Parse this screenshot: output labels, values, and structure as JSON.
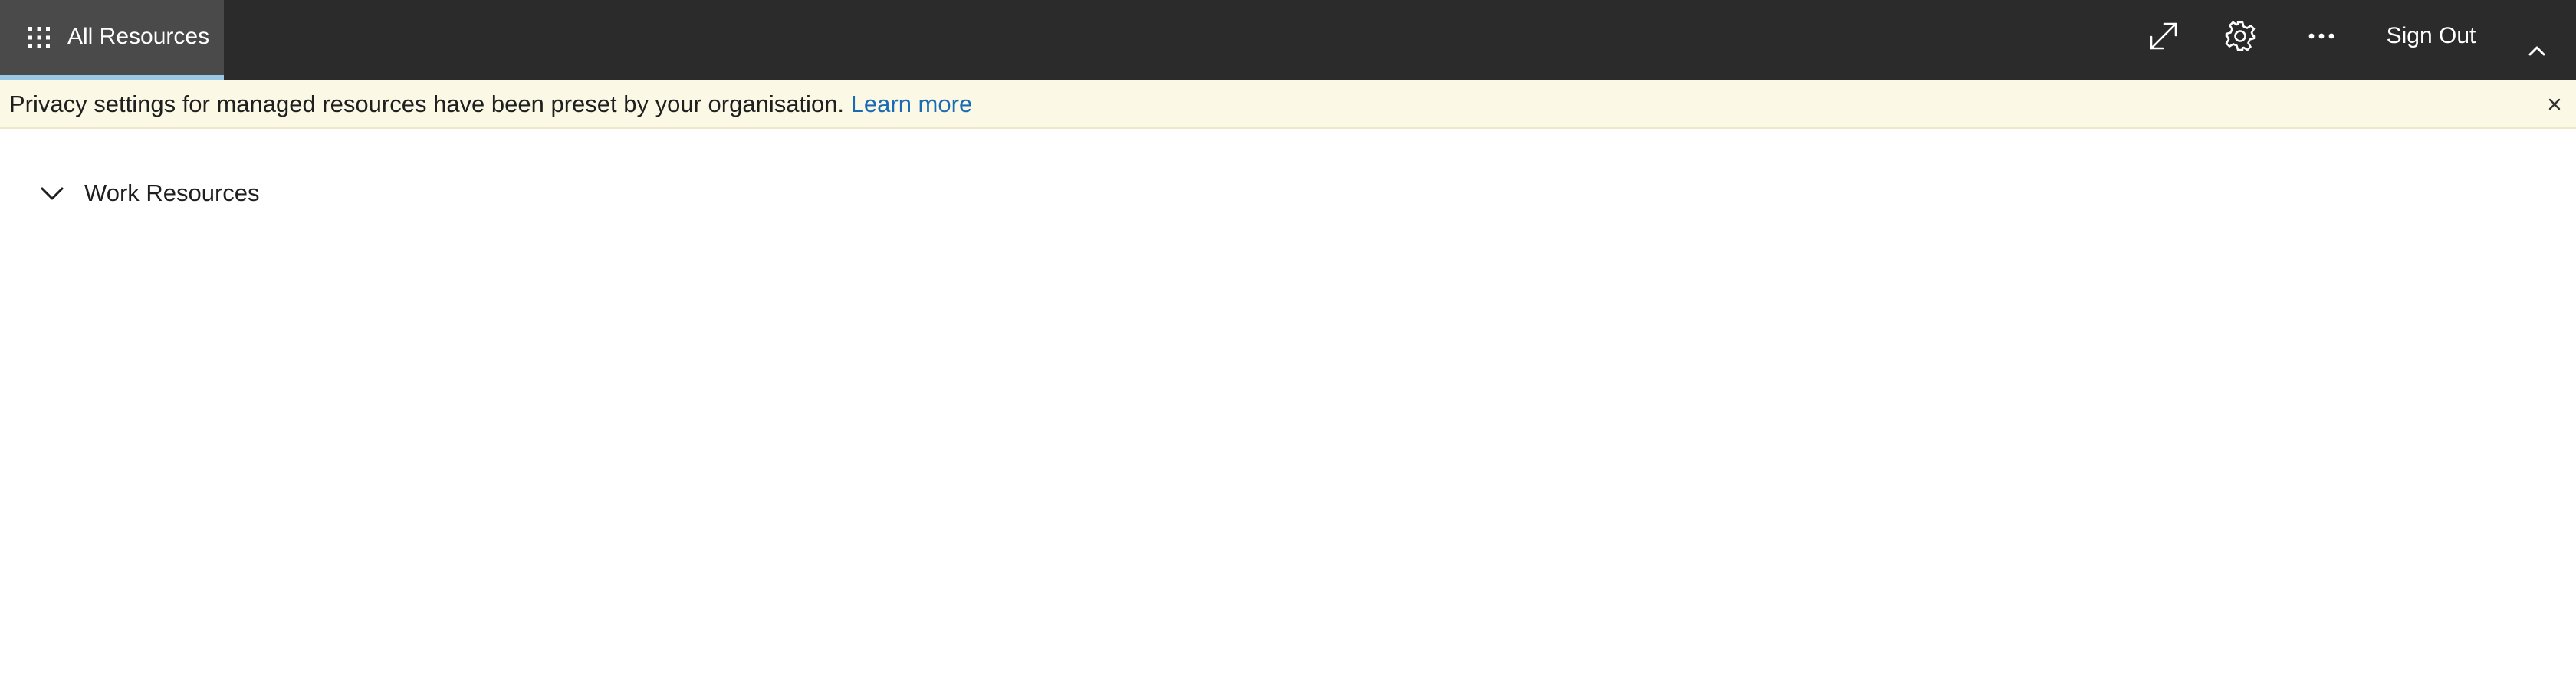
{
  "header": {
    "app_tab_label": "All Resources",
    "app_tab_icon": "waffle-icon",
    "actions": {
      "expand_icon": "expand-icon",
      "settings_icon": "gear-icon",
      "more_icon": "more-horizontal-icon",
      "sign_out_label": "Sign Out",
      "collapse_icon": "chevron-up-icon"
    },
    "colors": {
      "bar_bg": "#2b2b2b",
      "active_tab_bg": "#4a4a4a",
      "active_tab_underline": "#9ac7e6"
    }
  },
  "notice": {
    "message": "Privacy settings for managed resources have been preset by your organisation.",
    "link_label": "Learn more",
    "close_icon": "close-icon",
    "colors": {
      "bg": "#fbf8e6",
      "link": "#1a6ab4"
    }
  },
  "main": {
    "sections": [
      {
        "title": "Work Resources",
        "expanded": true,
        "toggle_icon": "chevron-down-icon"
      }
    ]
  }
}
